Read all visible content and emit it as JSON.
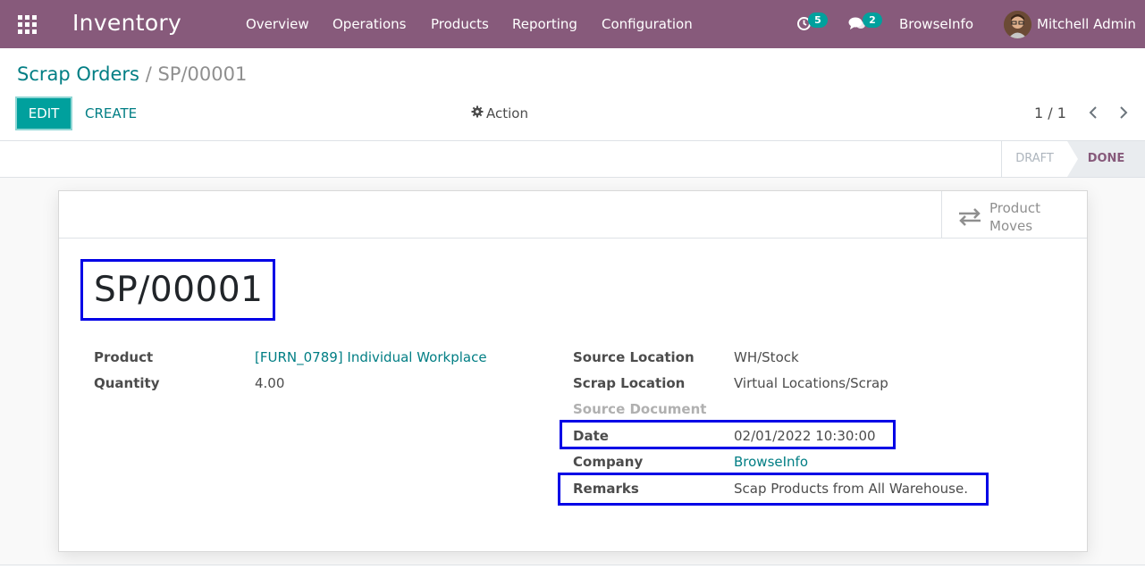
{
  "navbar": {
    "app_title": "Inventory",
    "menu": [
      "Overview",
      "Operations",
      "Products",
      "Reporting",
      "Configuration"
    ],
    "activity_count": "5",
    "message_count": "2",
    "company": "BrowseInfo",
    "user": "Mitchell Admin"
  },
  "breadcrumb": {
    "parent": "Scrap Orders",
    "separator": "/",
    "current": "SP/00001"
  },
  "toolbar": {
    "edit_label": "EDIT",
    "create_label": "CREATE",
    "action_label": "Action",
    "pager_value": "1 / 1"
  },
  "status": {
    "draft_label": "DRAFT",
    "done_label": "DONE"
  },
  "smart_button": {
    "line1": "Product",
    "line2": "Moves"
  },
  "record": {
    "name": "SP/00001",
    "left_fields": [
      {
        "label": "Product",
        "value": "[FURN_0789] Individual Workplace"
      },
      {
        "label": "Quantity",
        "value": "4.00"
      }
    ],
    "right_fields": [
      {
        "label": "Source Location",
        "value": "WH/Stock"
      },
      {
        "label": "Scrap Location",
        "value": "Virtual Locations/Scrap"
      },
      {
        "label": "Source Document",
        "value": ""
      },
      {
        "label": "Date",
        "value": "02/01/2022 10:30:00"
      },
      {
        "label": "Company",
        "value": "BrowseInfo"
      },
      {
        "label": "Remarks",
        "value": "Scap Products from All Warehouse."
      }
    ]
  },
  "colors": {
    "navbar": "#875a7b",
    "primary": "#00a09d",
    "link": "#017e84",
    "highlight": "#0000e6"
  }
}
